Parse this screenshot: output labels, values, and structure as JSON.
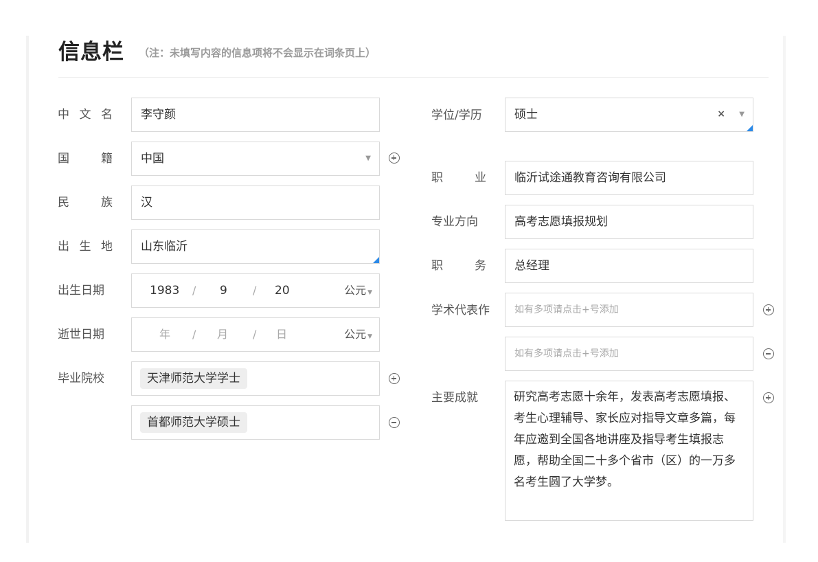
{
  "header": {
    "title": "信息栏",
    "note": "（注：未填写内容的信息项将不会显示在词条页上）"
  },
  "left": {
    "chinese_name": {
      "label_chars": [
        "中",
        "文",
        "名"
      ],
      "value": "李守颜"
    },
    "nationality": {
      "label_chars": [
        "国",
        "籍"
      ],
      "value": "中国"
    },
    "ethnicity": {
      "label_chars": [
        "民",
        "族"
      ],
      "value": "汉"
    },
    "birthplace": {
      "label_chars": [
        "出",
        "生",
        "地"
      ],
      "value": "山东临沂"
    },
    "birth_date": {
      "label": "出生日期",
      "year": "1983",
      "month": "9",
      "day": "20",
      "separator": "/",
      "era": "公元"
    },
    "death_date": {
      "label": "逝世日期",
      "year_ph": "年",
      "month_ph": "月",
      "day_ph": "日",
      "separator": "/",
      "era": "公元"
    },
    "school": {
      "label": "毕业院校",
      "tags": [
        "天津师范大学学士",
        "首都师范大学硕士"
      ]
    }
  },
  "right": {
    "degree": {
      "label": "学位/学历",
      "value": "硕士",
      "clear": "×"
    },
    "occupation": {
      "label_chars": [
        "职",
        "业"
      ],
      "value": "临沂试途通教育咨询有限公司"
    },
    "major": {
      "label": "专业方向",
      "value": "高考志愿填报规划"
    },
    "position": {
      "label_chars": [
        "职",
        "务"
      ],
      "value": "总经理"
    },
    "works": {
      "label": "学术代表作",
      "placeholders": [
        "如有多项请点击+号添加",
        "如有多项请点击+号添加"
      ]
    },
    "achievements": {
      "label": "主要成就",
      "value": "研究高考志愿十余年，发表高考志愿填报、考生心理辅导、家长应对指导文章多篇，每年应邀到全国各地讲座及指导考生填报志愿，帮助全国二十多个省市（区）的一万多名考生圆了大学梦。"
    }
  },
  "icons": {
    "caret": "▼"
  },
  "colors": {
    "accent_corner": "#2c8ae8",
    "border": "#d9d9d9",
    "tag_bg": "#eeeeee"
  }
}
